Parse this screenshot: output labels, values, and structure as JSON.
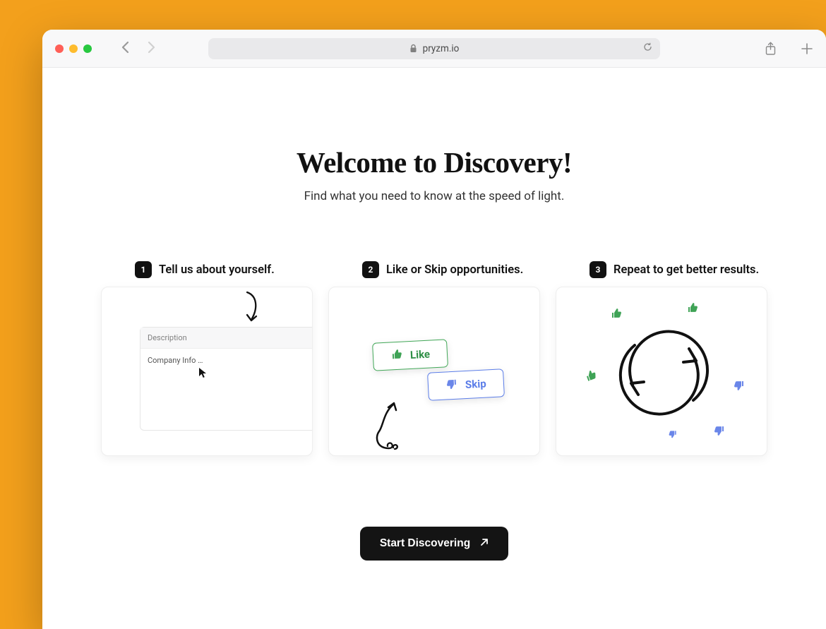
{
  "browser": {
    "url": "pryzm.io"
  },
  "hero": {
    "title": "Welcome to Discovery!",
    "subtitle": "Find what you need to know at the speed of light."
  },
  "steps": [
    {
      "number": "1",
      "title": "Tell us about yourself.",
      "form": {
        "label": "Description",
        "placeholder_text": "Company Info …"
      }
    },
    {
      "number": "2",
      "title": "Like or Skip opportunities.",
      "like_label": "Like",
      "skip_label": "Skip"
    },
    {
      "number": "3",
      "title": "Repeat to get better results."
    }
  ],
  "cta": {
    "label": "Start Discovering"
  },
  "colors": {
    "background": "#f3a01c",
    "green": "#3fa356",
    "blue": "#6a86e9",
    "black": "#111111"
  }
}
